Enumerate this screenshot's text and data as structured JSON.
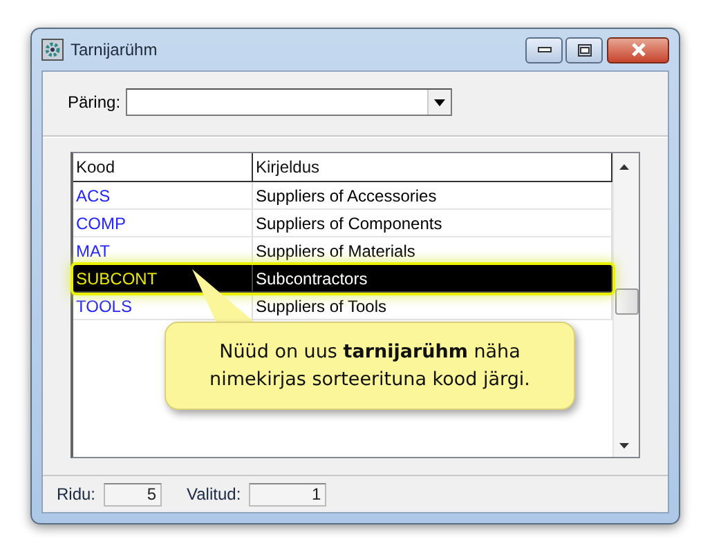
{
  "window": {
    "title": "Tarnijarühm"
  },
  "query": {
    "label": "Päring:"
  },
  "table": {
    "columns": [
      "Kood",
      "Kirjeldus"
    ],
    "rows": [
      {
        "code": "ACS",
        "description": "Suppliers of Accessories",
        "selected": false
      },
      {
        "code": "COMP",
        "description": "Suppliers of Components",
        "selected": false
      },
      {
        "code": "MAT",
        "description": "Suppliers of Materials",
        "selected": false
      },
      {
        "code": "SUBCONT",
        "description": "Subcontractors",
        "selected": true
      },
      {
        "code": "TOOLS",
        "description": "Suppliers of Tools",
        "selected": false
      }
    ]
  },
  "callout": {
    "text": "Nüüd on uus **tarnijarühm** näha nimekirjas sorteerituna kood järgi."
  },
  "status_bar": [
    {
      "label": "Ridu:",
      "value": "5"
    },
    {
      "label": "Valitud:",
      "value": "1"
    }
  ]
}
